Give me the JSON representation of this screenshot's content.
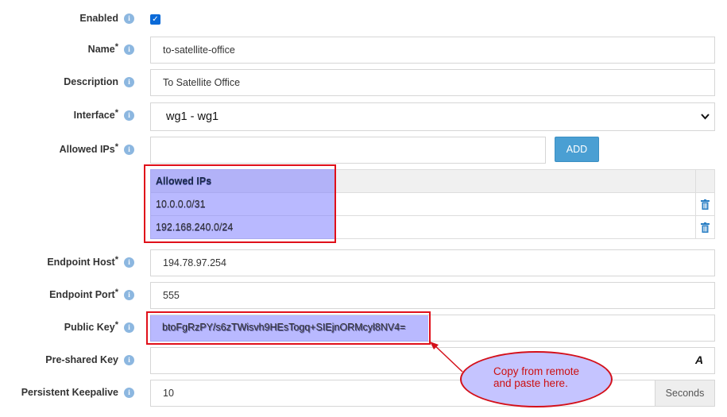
{
  "fields": {
    "enabled": {
      "label": "Enabled",
      "checked": true
    },
    "name": {
      "label": "Name",
      "required": "*",
      "value": "to-satellite-office"
    },
    "description": {
      "label": "Description",
      "value": "To Satellite Office"
    },
    "interface": {
      "label": "Interface",
      "required": "*",
      "value": "wg1 - wg1"
    },
    "allowed_ips": {
      "label": "Allowed IPs",
      "required": "*",
      "value": "",
      "add_label": "ADD"
    },
    "endpoint_host": {
      "label": "Endpoint Host",
      "required": "*",
      "value": "194.78.97.254"
    },
    "endpoint_port": {
      "label": "Endpoint Port",
      "required": "*",
      "value": "555"
    },
    "public_key": {
      "label": "Public Key",
      "required": "*",
      "value": "btoFgRzPY/s6zTWisvh9HEsTogq+SIEjnORMcyl8NV4="
    },
    "preshared_key": {
      "label": "Pre-shared Key",
      "value": "",
      "toggle_icon": "A"
    },
    "persistent_keepalive": {
      "label": "Persistent Keepalive",
      "value": "10",
      "unit": "Seconds"
    }
  },
  "allowed_ips_table": {
    "header": "Allowed IPs",
    "rows": [
      "10.0.0.0/31",
      "192.168.240.0/24"
    ]
  },
  "info_icon": "i",
  "annotation": {
    "text": "Copy from remote\nand paste here."
  },
  "colors": {
    "accent": "#4a9fd3",
    "info": "#8cb7e0",
    "highlight": "#8080ff",
    "annotation_border": "#e0101a"
  }
}
